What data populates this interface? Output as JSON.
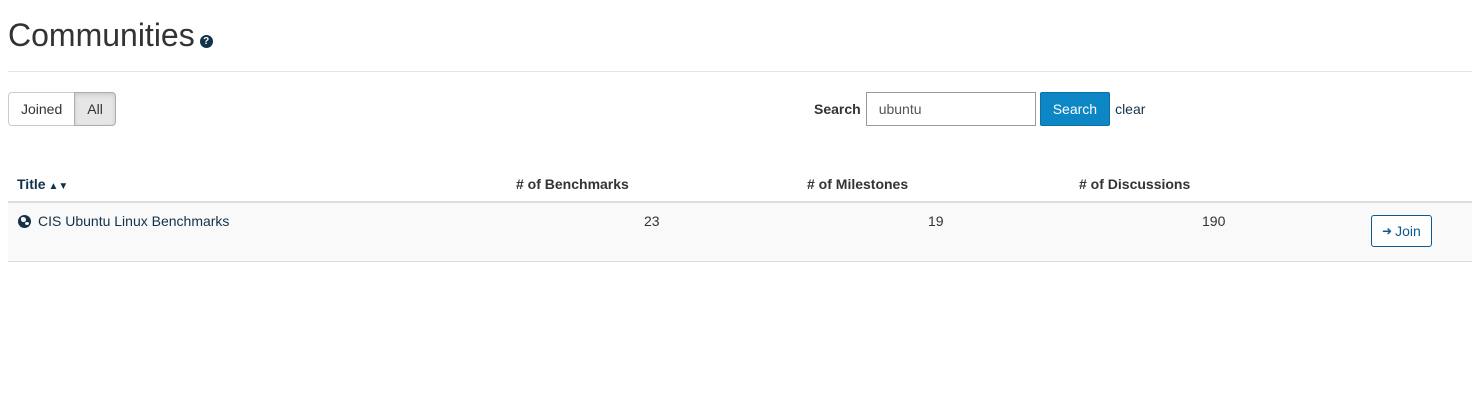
{
  "header": {
    "title": "Communities",
    "help_glyph": "?"
  },
  "filter": {
    "joined_label": "Joined",
    "all_label": "All",
    "active": "All"
  },
  "search": {
    "label": "Search",
    "value": "ubuntu",
    "button_label": "Search",
    "clear_label": "clear"
  },
  "table": {
    "columns": {
      "title": "Title",
      "benchmarks": "# of Benchmarks",
      "milestones": "# of Milestones",
      "discussions": "# of Discussions"
    },
    "rows": [
      {
        "title": "CIS Ubuntu Linux Benchmarks",
        "benchmarks": "23",
        "milestones": "19",
        "discussions": "190",
        "action_label": "Join"
      }
    ]
  },
  "icons": {
    "help": "question-circle-icon",
    "sort": "sort-icon",
    "globe": "globe-icon",
    "join": "sign-in-icon"
  },
  "colors": {
    "primary": "#0c86c5",
    "link": "#12324a",
    "row_bg": "#f9f9f9"
  }
}
